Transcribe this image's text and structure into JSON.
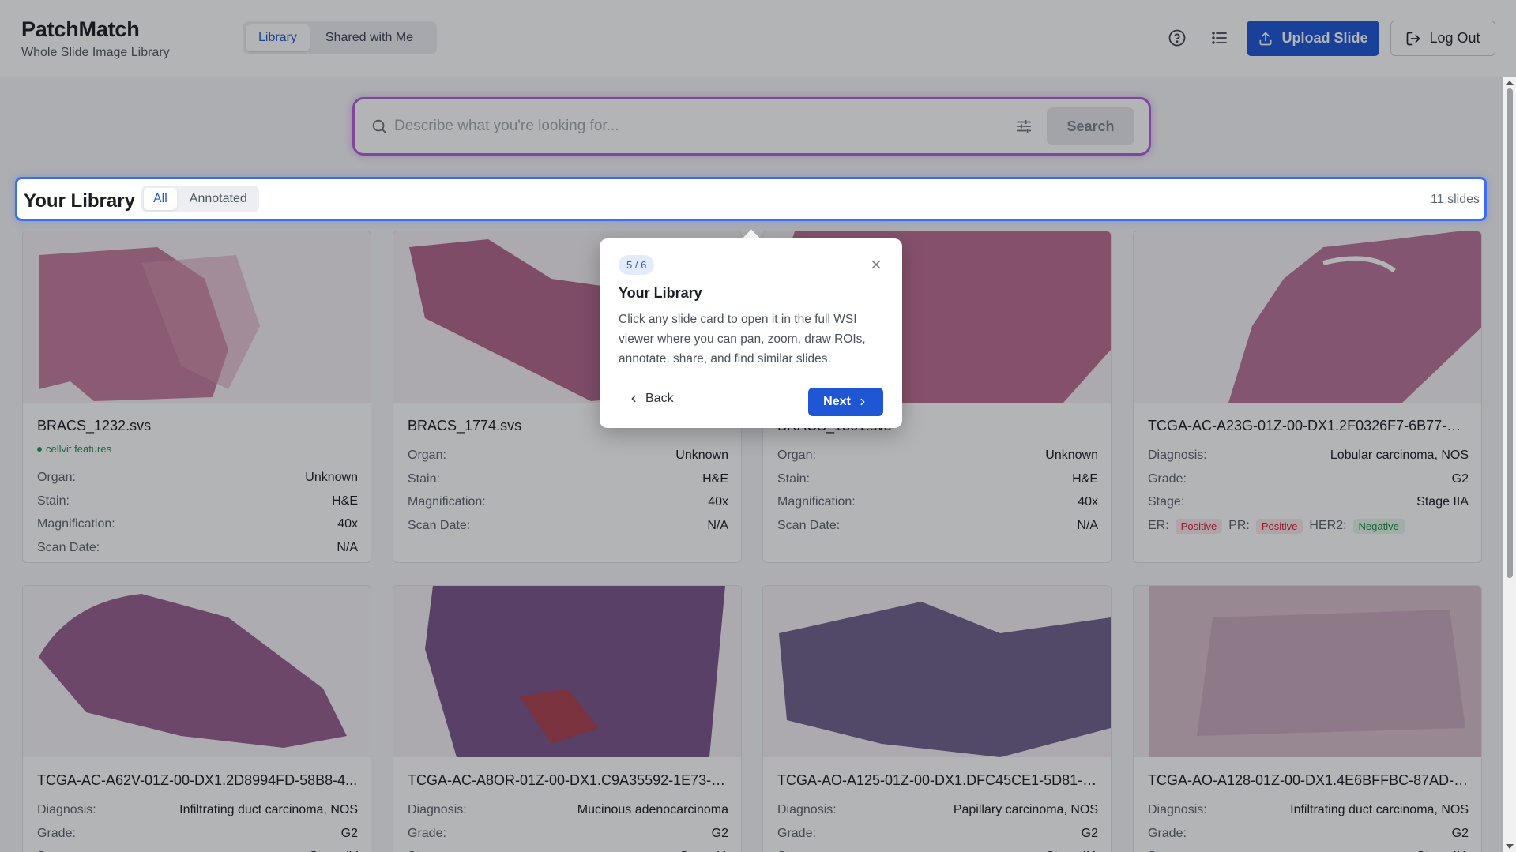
{
  "app": {
    "title": "PatchMatch",
    "subtitle": "Whole Slide Image Library"
  },
  "nav": {
    "tabs": [
      {
        "label": "Library",
        "active": true
      },
      {
        "label": "Shared with Me",
        "active": false
      }
    ]
  },
  "header_actions": {
    "help_icon": "help-circle-icon",
    "list_icon": "list-icon",
    "upload_label": "Upload Slide",
    "logout_label": "Log Out"
  },
  "search": {
    "placeholder": "Describe what you're looking for...",
    "value": "",
    "button_label": "Search"
  },
  "library": {
    "title": "Your Library",
    "filters": [
      {
        "label": "All",
        "active": true
      },
      {
        "label": "Annotated",
        "active": false
      }
    ],
    "count_label": "11 slides"
  },
  "cards": [
    {
      "title": "BRACS_1232.svs",
      "feature": "cellvit features",
      "rows": [
        [
          "Organ:",
          "Unknown"
        ],
        [
          "Stain:",
          "H&E"
        ],
        [
          "Magnification:",
          "40x"
        ],
        [
          "Scan Date:",
          "N/A"
        ]
      ]
    },
    {
      "title": "BRACS_1774.svs",
      "rows": [
        [
          "Organ:",
          "Unknown"
        ],
        [
          "Stain:",
          "H&E"
        ],
        [
          "Magnification:",
          "40x"
        ],
        [
          "Scan Date:",
          "N/A"
        ]
      ]
    },
    {
      "title": "BRACS_1861.svs",
      "rows": [
        [
          "Organ:",
          "Unknown"
        ],
        [
          "Stain:",
          "H&E"
        ],
        [
          "Magnification:",
          "40x"
        ],
        [
          "Scan Date:",
          "N/A"
        ]
      ]
    },
    {
      "title": "TCGA-AC-A23G-01Z-00-DX1.2F0326F7-6B77-4B...",
      "rows": [
        [
          "Diagnosis:",
          "Lobular carcinoma, NOS"
        ],
        [
          "Grade:",
          "G2"
        ],
        [
          "Stage:",
          "Stage IIA"
        ]
      ],
      "receptors": {
        "er_label": "ER:",
        "er_value": "Positive",
        "pr_label": "PR:",
        "pr_value": "Positive",
        "her2_label": "HER2:",
        "her2_value": "Negative"
      }
    },
    {
      "title": "TCGA-AC-A62V-01Z-00-DX1.2D8994FD-58B8-4...",
      "rows": [
        [
          "Diagnosis:",
          "Infiltrating duct carcinoma, NOS"
        ],
        [
          "Grade:",
          "G2"
        ],
        [
          "Stage:",
          "Stage IV"
        ]
      ]
    },
    {
      "title": "TCGA-AC-A8OR-01Z-00-DX1.C9A35592-1E73-40...",
      "rows": [
        [
          "Diagnosis:",
          "Mucinous adenocarcinoma"
        ],
        [
          "Grade:",
          "G2"
        ],
        [
          "Stage:",
          "Stage IA"
        ]
      ]
    },
    {
      "title": "TCGA-AO-A125-01Z-00-DX1.DFC45CE1-5D81-4C...",
      "rows": [
        [
          "Diagnosis:",
          "Papillary carcinoma, NOS"
        ],
        [
          "Grade:",
          "G2"
        ],
        [
          "Stage:",
          "Stage IIA"
        ]
      ]
    },
    {
      "title": "TCGA-AO-A128-01Z-00-DX1.4E6BFFBC-87AD-4E...",
      "rows": [
        [
          "Diagnosis:",
          "Infiltrating duct carcinoma, NOS"
        ],
        [
          "Grade:",
          "G2"
        ],
        [
          "Stage:",
          "Stage IIA"
        ]
      ]
    }
  ],
  "tour": {
    "step": "5 / 6",
    "title": "Your Library",
    "body": "Click any slide card to open it in the full WSI viewer where you can pan, zoom, draw ROIs, annotate, share, and find similar slides.",
    "back_label": "Back",
    "next_label": "Next"
  },
  "colors": {
    "primary": "#1e56d4",
    "search_glow": "#b061d9",
    "library_highlight": "#3b6ff0",
    "positive": "#cc2236",
    "negative": "#1d8a45"
  }
}
